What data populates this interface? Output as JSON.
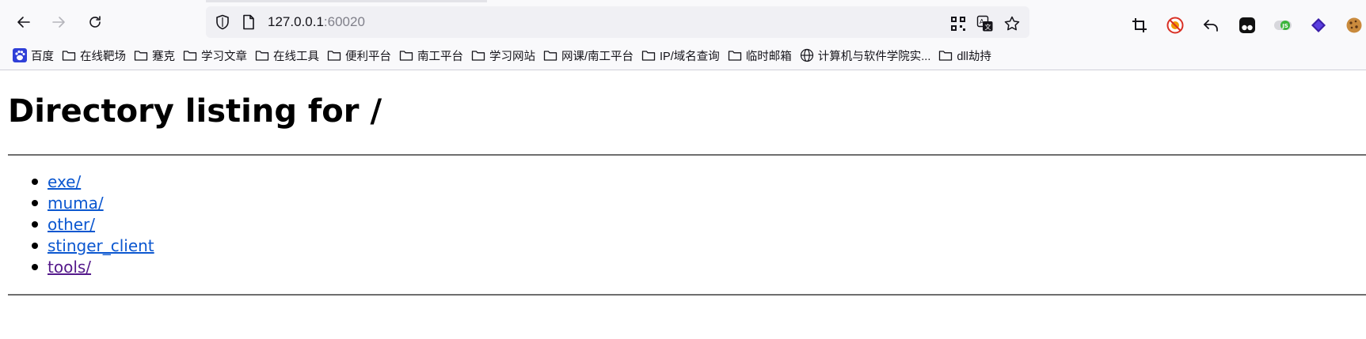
{
  "browser": {
    "url_host": "127.0.0.1",
    "url_port": ":60020",
    "bookmarks": [
      {
        "label": "百度",
        "icon": "baidu-paw-icon"
      },
      {
        "label": "在线靶场",
        "icon": "folder-icon"
      },
      {
        "label": "蹇克",
        "icon": "folder-icon"
      },
      {
        "label": "学习文章",
        "icon": "folder-icon"
      },
      {
        "label": "在线工具",
        "icon": "folder-icon"
      },
      {
        "label": "便利平台",
        "icon": "folder-icon"
      },
      {
        "label": "南工平台",
        "icon": "folder-icon"
      },
      {
        "label": "学习网站",
        "icon": "folder-icon"
      },
      {
        "label": "网课/南工平台",
        "icon": "folder-icon"
      },
      {
        "label": "IP/域名查询",
        "icon": "folder-icon"
      },
      {
        "label": "临时邮箱",
        "icon": "folder-icon"
      },
      {
        "label": "计算机与软件学院实...",
        "icon": "globe-icon"
      },
      {
        "label": "dll劫持",
        "icon": "folder-icon"
      }
    ],
    "colors": {
      "accent_link": "#0b57d0",
      "visited_link": "#551a8b",
      "chrome_bg": "#f9f9fb",
      "urlbar_bg": "#f0f0f4"
    }
  },
  "page": {
    "title": "Directory listing for /",
    "entries": [
      {
        "label": "exe/",
        "visited": false
      },
      {
        "label": "muma/",
        "visited": false
      },
      {
        "label": "other/",
        "visited": false
      },
      {
        "label": "stinger_client",
        "visited": false
      },
      {
        "label": "tools/",
        "visited": true
      }
    ]
  }
}
